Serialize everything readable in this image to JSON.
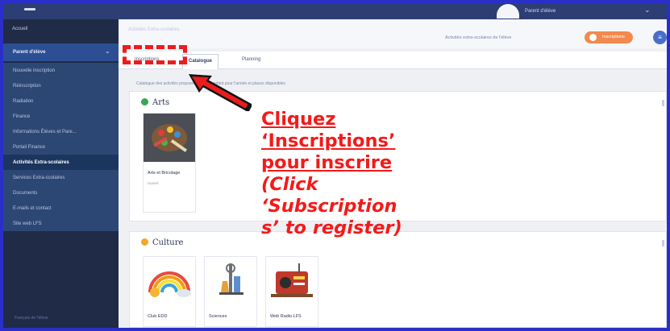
{
  "topbar": {
    "user_name": "Parent d'élève"
  },
  "sidebar": {
    "home": "Accueil",
    "section": "Parent d'élève",
    "items": [
      {
        "label": "Nouvelle inscription"
      },
      {
        "label": "Réinscription"
      },
      {
        "label": "Radiation"
      },
      {
        "label": "Finance"
      },
      {
        "label": "Informations Élèves et Pare..."
      },
      {
        "label": "Portail Finance"
      },
      {
        "label": "Activités Extra-scolaires",
        "active": true
      },
      {
        "label": "Services Extra-scolaires"
      },
      {
        "label": "Documents"
      },
      {
        "label": "E-mails et contact"
      },
      {
        "label": "Site web LFS"
      }
    ],
    "footer": "Français de l'élève"
  },
  "header": {
    "title": "Activités Extra-scolaires",
    "link": "Activités extra-scolaires de l'élève",
    "button": "Inscriptions",
    "round_button": "≡"
  },
  "tabs": [
    {
      "label": "Inscriptions",
      "selected": false
    },
    {
      "label": "Catalogue",
      "selected": true
    },
    {
      "label": "Planning",
      "selected": false
    }
  ],
  "tab_description": "Catalogue des activités proposées à votre enfant pour l'année et places disponibles",
  "panels": {
    "arts": {
      "title": "Arts",
      "dot_color": "#3aa457",
      "cards": [
        {
          "label": "Arts et Bricolage",
          "meta": "Ouvert"
        }
      ]
    },
    "culture": {
      "title": "Culture",
      "dot_color": "#f5a623",
      "cards": [
        {
          "label": "Club EDD",
          "icon": "rainbow-icon"
        },
        {
          "label": "Sciences",
          "icon": "science-icon"
        },
        {
          "label": "Web Radio LFS",
          "icon": "radio-icon"
        }
      ]
    }
  },
  "annotation": {
    "lines": [
      "Cliquez",
      "‘Inscriptions’",
      "pour inscrire",
      "(Click",
      "‘Subscription",
      "s’ to register)"
    ],
    "color": "#f41a1a"
  }
}
